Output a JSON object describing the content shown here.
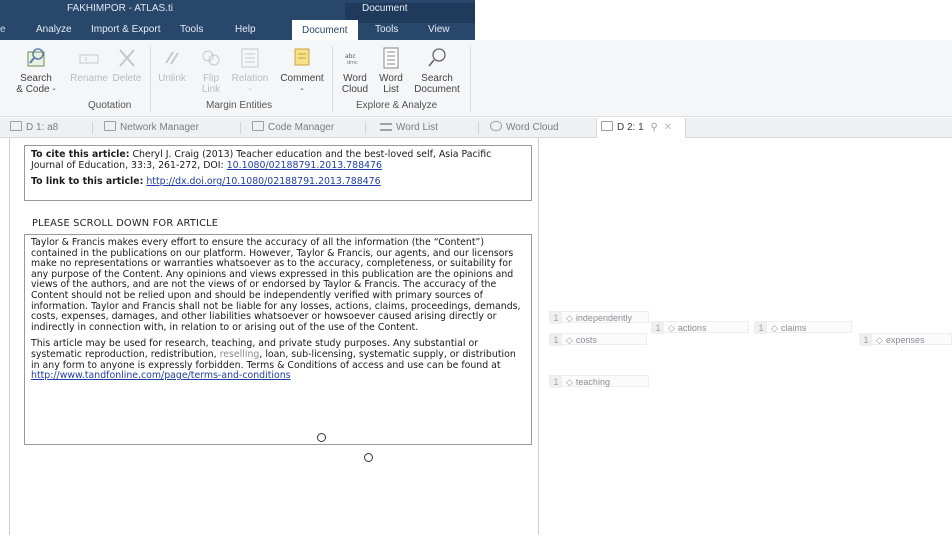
{
  "window": {
    "app_title": "FAKHIMPOR - ATLAS.ti",
    "context_title": "Document",
    "left_clip": "e"
  },
  "menu": [
    "Analyze",
    "Import & Export",
    "Tools",
    "Help",
    "Document",
    "Tools",
    "View"
  ],
  "menu_active": "Document",
  "ribbon": {
    "buttons": [
      {
        "label": "Search\n& Code -",
        "icon": "search-code-icon",
        "enabled": true
      },
      {
        "label": "Rename",
        "icon": "rename-icon",
        "enabled": false
      },
      {
        "label": "Delete",
        "icon": "delete-icon",
        "enabled": false
      },
      {
        "label": "Unlink",
        "icon": "unlink-icon",
        "enabled": false
      },
      {
        "label": "Flip\nLink",
        "icon": "flip-link-icon",
        "enabled": false
      },
      {
        "label": "Relation\n-",
        "icon": "relation-icon",
        "enabled": false
      },
      {
        "label": "Comment\n-",
        "icon": "comment-icon",
        "enabled": true
      },
      {
        "label": "Word\nCloud",
        "icon": "word-cloud-icon",
        "enabled": true
      },
      {
        "label": "Word\nList",
        "icon": "word-list-icon",
        "enabled": true
      },
      {
        "label": "Search\nDocument",
        "icon": "search-document-icon",
        "enabled": true
      }
    ],
    "groups": [
      "Quotation",
      "Margin Entities",
      "Explore & Analyze"
    ]
  },
  "tabs": [
    {
      "label": "D 1: a8",
      "icon": "document-icon"
    },
    {
      "label": "Network Manager",
      "icon": "network-icon"
    },
    {
      "label": "Code Manager",
      "icon": "code-manager-icon"
    },
    {
      "label": "Word List",
      "icon": "list-icon"
    },
    {
      "label": "Word Cloud",
      "icon": "cloud-icon"
    },
    {
      "label": "D 2: 1",
      "icon": "document-icon",
      "active": true,
      "pin": "⚲",
      "close": "✕"
    }
  ],
  "document": {
    "cite_label": "To cite this article:",
    "cite_text": " Cheryl J. Craig (2013) Teacher education and the best-loved self, Asia Pacific Journal of Education, 33:3, 261-272, DOI: ",
    "cite_doi": "10.1080/02188791.2013.788476",
    "link_label": "To link to this article:",
    "link_url": "http://dx.doi.org/10.1080/02188791.2013.788476",
    "scroll_msg": "PLEASE SCROLL DOWN FOR ARTICLE",
    "para1": "Taylor & Francis makes every effort to ensure the accuracy of all the information (the “Content”) contained in the publications on our platform. However, Taylor & Francis, our agents, and our licensors make no representations or warranties whatsoever as to the accuracy, completeness, or suitability for any purpose of the Content. Any opinions and views expressed in this publication are the opinions and views of the authors, and are not the views of or endorsed by Taylor & Francis. The accuracy of the Content should not be relied upon and should be independently verified with primary sources of information. Taylor and Francis shall not be liable for any losses, actions, claims, proceedings, demands, costs, expenses, damages, and other liabilities whatsoever or howsoever caused arising directly or indirectly in connection with, in relation to or arising out of the use of the Content.",
    "para2_a": "This article may be used for research, teaching, and private study purposes. Any substantial or systematic reproduction, redistribution, ",
    "para2_faded": "reselling",
    "para2_b": ", loan, sub-licensing, systematic supply, or distribution in any form to anyone is expressly forbidden. Terms & Conditions of access and use can be found at ",
    "para2_link": "http://www.tandfonline.com/page/terms-and-conditions"
  },
  "margin_codes": [
    {
      "label": "independently",
      "num": "1"
    },
    {
      "label": "actions",
      "num": "1"
    },
    {
      "label": "claims",
      "num": "1"
    },
    {
      "label": "costs",
      "num": "1"
    },
    {
      "label": "expenses",
      "num": "1"
    },
    {
      "label": "teaching",
      "num": "1"
    }
  ]
}
